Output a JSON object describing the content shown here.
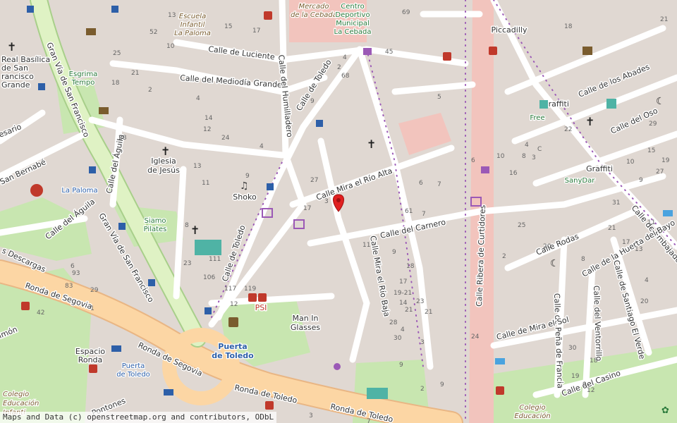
{
  "streets": {
    "luciente": "Calle de Luciente",
    "mediodia": "Calle del Mediodía Grande",
    "humilladero": "Calle del Humilladero",
    "gran_via_1": "Gran Vía de San Francisco",
    "gran_via_2": "Gran Vía de San Francisco",
    "aguila_1": "Calle del Águila",
    "aguila_2": "Calle del Águila",
    "san_bernabe": "San Bernabé",
    "mira_rio_alta": "Calle Mira el Río Alta",
    "mira_rio_baja": "Calle Mira el Río Baja",
    "carnero": "Calle del Carnero",
    "ribera": "Calle Ribera de Curtidores",
    "toledo_1": "Calle de Toledo",
    "toledo_2": "Calle de Toledo",
    "ronda_segovia_1": "Ronda de Segovia",
    "ronda_segovia_2": "Ronda de Segovia",
    "ronda_toledo_1": "Ronda de Toledo",
    "ronda_toledo_2": "Ronda de Toledo",
    "descargas": "s Descargas",
    "pontones": "Pontones",
    "abades": "Calle de los Abades",
    "oso": "Calle del Oso",
    "embajadores": "Calle de Embajadores",
    "rodas": "Calle Rodas",
    "huerta_bayo": "Calle de la Huerta del Bayo",
    "santiago_verde": "Calle de Santiago El Verde",
    "ventorrillo": "Calle del Ventorrillo",
    "pena_francia": "Calle de Peña de Francia",
    "mira_sol": "Calle de Mira el Sol",
    "casino": "Calle del Casino",
    "ecario": "esario",
    "imon": "imón"
  },
  "pois": {
    "mercado": [
      "Mercado",
      "de la Cebada"
    ],
    "centro": [
      "Centro",
      "Deportivo",
      "Municipal",
      "La Cebada"
    ],
    "escuela": [
      "Escuela",
      "Infantil",
      "La Paloma"
    ],
    "basilica": [
      "Real Basílica",
      "de San",
      "rancisco",
      "Grande"
    ],
    "esgrima": [
      "Esgrima",
      "Tempo"
    ],
    "iglesia": [
      "Iglesia",
      "de Jesús"
    ],
    "paloma": "La Paloma",
    "siamo": [
      "Siamo",
      "Pilates"
    ],
    "shoko": "Shoko",
    "psi": "PSI",
    "man_in_glasses": [
      "Man In",
      "Glasses"
    ],
    "puerta_toledo": [
      "Puerta",
      "de Toledo"
    ],
    "puerta_toledo_metro": [
      "Puerta",
      "de Toledo"
    ],
    "espacio_ronda": [
      "Espacio",
      "Ronda"
    ],
    "colegio_left": [
      "Colegio",
      "Educación",
      "Infanti"
    ],
    "colegio_right": [
      "Colegio",
      "Educación"
    ],
    "piccadilly": "Piccadilly",
    "graffiti_1": "Graffiti",
    "graffiti_2": "Graffiti",
    "free": "Free",
    "sanydar": "SanyDar"
  },
  "house_numbers": [
    "69",
    "18",
    "21",
    "13",
    "52",
    "15",
    "17",
    "4",
    "2",
    "68",
    "45",
    "25",
    "10",
    "18",
    "21",
    "2",
    "4",
    "14",
    "12",
    "24",
    "4",
    "9",
    "27",
    "9",
    "28",
    "17",
    "19-21",
    "13",
    "11",
    "17",
    "3",
    "7",
    "6",
    "61",
    "11",
    "23",
    "106",
    "111",
    "12",
    "117",
    "119",
    "23",
    "21",
    "1",
    "42",
    "93",
    "83",
    "29",
    "6",
    "4",
    "8",
    "14",
    "3",
    "6",
    "10",
    "4",
    "8",
    "16",
    "3",
    "C",
    "5",
    "7",
    "9",
    "18",
    "21",
    "22",
    "30",
    "28",
    "24",
    "29",
    "31",
    "10",
    "2",
    "25",
    "20",
    "21",
    "8",
    "17",
    "11",
    "13",
    "19",
    "15",
    "27",
    "9",
    "4",
    "20",
    "30",
    "18",
    "12",
    "19",
    "9",
    "9",
    "9",
    "2",
    "7",
    "3"
  ],
  "attribution": "Maps and Data (c) openstreetmap.org and contributors, ODbL",
  "marker": {
    "label": "location-marker"
  },
  "colors": {
    "land": "#e0d8d2",
    "road": "#ffffff",
    "primary": "#fcd6a4",
    "trunk": "#bde2a4",
    "park": "#c8e6b0",
    "marker": "#e02020",
    "pedestrian": "#f2c4bd"
  }
}
